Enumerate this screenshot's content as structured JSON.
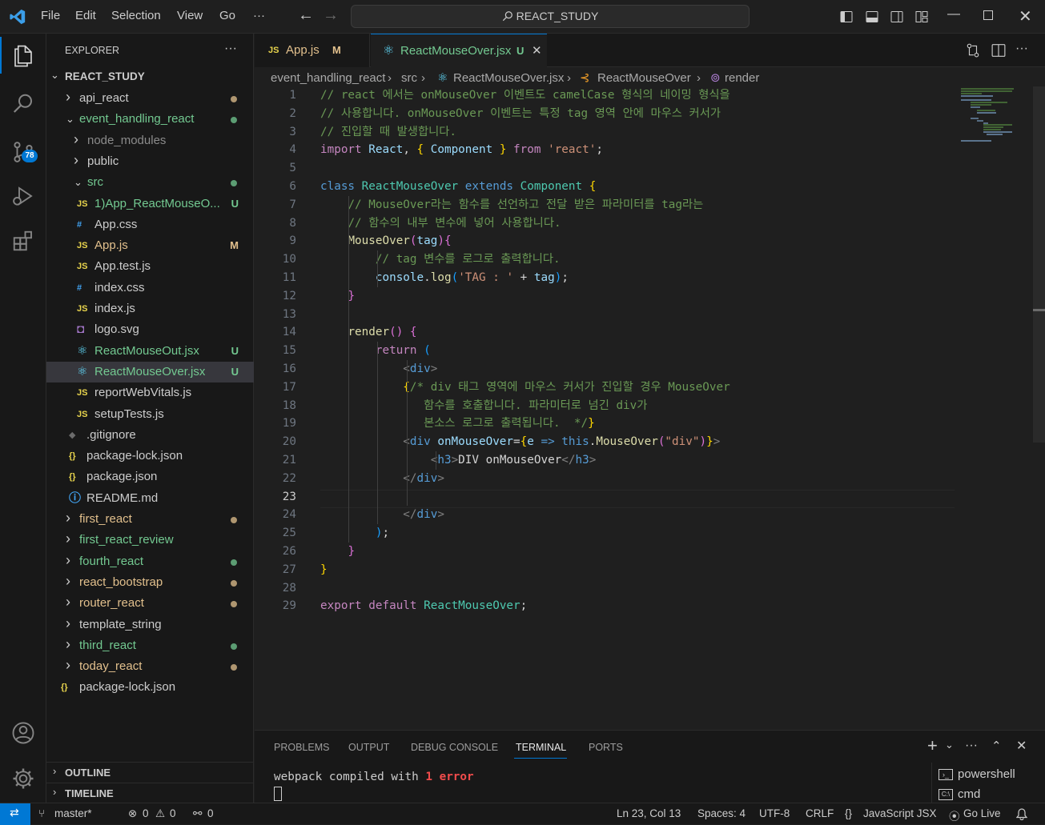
{
  "menu": {
    "file": "File",
    "edit": "Edit",
    "selection": "Selection",
    "view": "View",
    "go": "Go",
    "more": "···"
  },
  "search": {
    "text": "REACT_STUDY"
  },
  "activity": {
    "scm_badge": "78"
  },
  "explorer": {
    "title": "EXPLORER",
    "more": "···",
    "root": "REACT_STUDY",
    "items": [
      {
        "label": "api_react",
        "kind": "folder",
        "color": "#cccccc"
      },
      {
        "label": "event_handling_react",
        "kind": "folder-open",
        "color": "#73c991"
      },
      {
        "label": "node_modules",
        "kind": "folder",
        "color": "#8b8b8b"
      },
      {
        "label": "public",
        "kind": "folder",
        "color": "#cccccc"
      },
      {
        "label": "src",
        "kind": "folder-open",
        "color": "#73c991"
      },
      {
        "label": "1)App_ReactMouseO...",
        "kind": "js",
        "color": "#73c991",
        "badge": "U"
      },
      {
        "label": "App.css",
        "kind": "css",
        "color": "#cccccc"
      },
      {
        "label": "App.js",
        "kind": "js",
        "color": "#e2c08d",
        "badge": "M"
      },
      {
        "label": "App.test.js",
        "kind": "js",
        "color": "#cccccc"
      },
      {
        "label": "index.css",
        "kind": "css",
        "color": "#cccccc"
      },
      {
        "label": "index.js",
        "kind": "js",
        "color": "#cccccc"
      },
      {
        "label": "logo.svg",
        "kind": "svg",
        "color": "#cccccc"
      },
      {
        "label": "ReactMouseOut.jsx",
        "kind": "react",
        "color": "#73c991",
        "badge": "U"
      },
      {
        "label": "ReactMouseOver.jsx",
        "kind": "react",
        "color": "#73c991",
        "badge": "U"
      },
      {
        "label": "reportWebVitals.js",
        "kind": "js",
        "color": "#cccccc"
      },
      {
        "label": "setupTests.js",
        "kind": "js",
        "color": "#cccccc"
      },
      {
        "label": ".gitignore",
        "kind": "git",
        "color": "#cccccc"
      },
      {
        "label": "package-lock.json",
        "kind": "json",
        "color": "#cccccc"
      },
      {
        "label": "package.json",
        "kind": "json",
        "color": "#cccccc"
      },
      {
        "label": "README.md",
        "kind": "info",
        "color": "#cccccc"
      },
      {
        "label": "first_react",
        "kind": "folder",
        "color": "#e2c08d"
      },
      {
        "label": "first_react_review",
        "kind": "folder",
        "color": "#73c991"
      },
      {
        "label": "fourth_react",
        "kind": "folder",
        "color": "#73c991"
      },
      {
        "label": "react_bootstrap",
        "kind": "folder",
        "color": "#e2c08d"
      },
      {
        "label": "router_react",
        "kind": "folder",
        "color": "#e2c08d"
      },
      {
        "label": "template_string",
        "kind": "folder",
        "color": "#cccccc"
      },
      {
        "label": "third_react",
        "kind": "folder",
        "color": "#73c991"
      },
      {
        "label": "today_react",
        "kind": "folder",
        "color": "#e2c08d"
      },
      {
        "label": "package-lock.json",
        "kind": "json-root",
        "color": "#cccccc"
      }
    ],
    "outline": "OUTLINE",
    "timeline": "TIMELINE"
  },
  "tabs": [
    {
      "icon": "JS",
      "label": "App.js",
      "badge": "M",
      "active": false
    },
    {
      "icon": "⚛",
      "label": "ReactMouseOver.jsx",
      "badge": "U",
      "active": true
    }
  ],
  "breadcrumb": [
    "event_handling_react",
    "src",
    "ReactMouseOver.jsx",
    "ReactMouseOver",
    "render"
  ],
  "code_lines": [
    [
      [
        "cm",
        "// react 에서는 onMouseOver 이벤트도 camelCase 형식의 네이밍 형식을"
      ]
    ],
    [
      [
        "cm",
        "// 사용합니다. onMouseOver 이벤트는 특정 tag 영역 안에 마우스 커서가"
      ]
    ],
    [
      [
        "cm",
        "// 진입할 때 발생합니다."
      ]
    ],
    [
      [
        "kc",
        "import "
      ],
      [
        "vr",
        "React"
      ],
      [
        "pl",
        ", "
      ],
      [
        "br1",
        "{ "
      ],
      [
        "vr",
        "Component"
      ],
      [
        "br1",
        " }"
      ],
      [
        "kc",
        " from "
      ],
      [
        "st",
        "'react'"
      ],
      [
        "pl",
        ";"
      ]
    ],
    [],
    [
      [
        "kw",
        "class "
      ],
      [
        "cls",
        "ReactMouseOver "
      ],
      [
        "kw",
        "extends "
      ],
      [
        "cls",
        "Component "
      ],
      [
        "br1",
        "{"
      ]
    ],
    [
      [
        "pl",
        "    "
      ],
      [
        "cm",
        "// MouseOver라는 함수를 선언하고 전달 받은 파라미터를 tag라는"
      ]
    ],
    [
      [
        "pl",
        "    "
      ],
      [
        "cm",
        "// 함수의 내부 변수에 넣어 사용합니다."
      ]
    ],
    [
      [
        "pl",
        "    "
      ],
      [
        "fn",
        "MouseOver"
      ],
      [
        "br2",
        "("
      ],
      [
        "vr",
        "tag"
      ],
      [
        "br2",
        ")"
      ],
      [
        "br2",
        "{"
      ]
    ],
    [
      [
        "pl",
        "        "
      ],
      [
        "cm",
        "// tag 변수를 로그로 출력합니다."
      ]
    ],
    [
      [
        "pl",
        "        "
      ],
      [
        "vr",
        "console"
      ],
      [
        "pl",
        "."
      ],
      [
        "fn",
        "log"
      ],
      [
        "br3",
        "("
      ],
      [
        "st",
        "'TAG : '"
      ],
      [
        "pl",
        " + "
      ],
      [
        "vr",
        "tag"
      ],
      [
        "br3",
        ")"
      ],
      [
        "pl",
        ";"
      ]
    ],
    [
      [
        "pl",
        "    "
      ],
      [
        "br2",
        "}"
      ]
    ],
    [],
    [
      [
        "pl",
        "    "
      ],
      [
        "fn",
        "render"
      ],
      [
        "br2",
        "()"
      ],
      [
        "pl",
        " "
      ],
      [
        "br2",
        "{"
      ]
    ],
    [
      [
        "pl",
        "        "
      ],
      [
        "kc",
        "return "
      ],
      [
        "br3",
        "("
      ]
    ],
    [
      [
        "pl",
        "            "
      ],
      [
        "tgn",
        "<"
      ],
      [
        "tg",
        "div"
      ],
      [
        "tgn",
        ">"
      ]
    ],
    [
      [
        "pl",
        "            "
      ],
      [
        "br1",
        "{"
      ],
      [
        "cm",
        "/* div 태그 영역에 마우스 커서가 진입할 경우 MouseOver"
      ]
    ],
    [
      [
        "pl",
        "            "
      ],
      [
        "cm",
        "   함수를 호출합니다. 파라미터로 넘긴 div가"
      ]
    ],
    [
      [
        "pl",
        "            "
      ],
      [
        "cm",
        "   본소스 로그로 출력됩니다.  */"
      ],
      [
        "br1",
        "}"
      ]
    ],
    [
      [
        "pl",
        "            "
      ],
      [
        "tgn",
        "<"
      ],
      [
        "tg",
        "div "
      ],
      [
        "vr",
        "onMouseOver"
      ],
      [
        "pl",
        "="
      ],
      [
        "br1",
        "{"
      ],
      [
        "vr",
        "e"
      ],
      [
        "kw",
        " => "
      ],
      [
        "kw",
        "this"
      ],
      [
        "pl",
        "."
      ],
      [
        "fn",
        "MouseOver"
      ],
      [
        "br2",
        "("
      ],
      [
        "st",
        "\"div\""
      ],
      [
        "br2",
        ")"
      ],
      [
        "br1",
        "}"
      ],
      [
        "tgn",
        ">"
      ]
    ],
    [
      [
        "pl",
        "                "
      ],
      [
        "tgn",
        "<"
      ],
      [
        "tg",
        "h3"
      ],
      [
        "tgn",
        ">"
      ],
      [
        "pl",
        "DIV onMouseOver"
      ],
      [
        "tgn",
        "</"
      ],
      [
        "tg",
        "h3"
      ],
      [
        "tgn",
        ">"
      ]
    ],
    [
      [
        "pl",
        "            "
      ],
      [
        "tgn",
        "</"
      ],
      [
        "tg",
        "div"
      ],
      [
        "tgn",
        ">"
      ]
    ],
    [],
    [
      [
        "pl",
        "            "
      ],
      [
        "tgn",
        "</"
      ],
      [
        "tg",
        "div"
      ],
      [
        "tgn",
        ">"
      ]
    ],
    [
      [
        "pl",
        "        "
      ],
      [
        "br3",
        ")"
      ],
      [
        "pl",
        ";"
      ]
    ],
    [
      [
        "pl",
        "    "
      ],
      [
        "br2",
        "}"
      ]
    ],
    [
      [
        "br1",
        "}"
      ]
    ],
    [],
    [
      [
        "kc",
        "export "
      ],
      [
        "kc",
        "default "
      ],
      [
        "cls",
        "ReactMouseOver"
      ],
      [
        "pl",
        ";"
      ]
    ]
  ],
  "panel": {
    "tabs": [
      "PROBLEMS",
      "OUTPUT",
      "DEBUG CONSOLE",
      "TERMINAL",
      "PORTS"
    ],
    "active": "TERMINAL",
    "terminal_prefix": "webpack compiled with ",
    "terminal_count": "1",
    "terminal_suffix": " error",
    "shells": [
      "powershell",
      "cmd"
    ]
  },
  "status": {
    "branch": "master*",
    "errors": "0",
    "warnings": "0",
    "ports": "0",
    "position": "Ln 23, Col 13",
    "spaces": "Spaces: 4",
    "encoding": "UTF-8",
    "eol": "CRLF",
    "language": "JavaScript JSX",
    "golive": "Go Live"
  }
}
